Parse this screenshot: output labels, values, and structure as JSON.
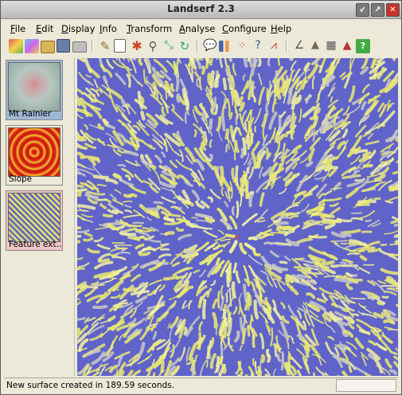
{
  "window": {
    "title": "Landserf 2.3"
  },
  "menu": [
    "File",
    "Edit",
    "Display",
    "Info",
    "Transform",
    "Analyse",
    "Configure",
    "Help"
  ],
  "toolbar_icons": [
    "new-surface-icon",
    "new-raster-icon",
    "open-folder-icon",
    "save-icon",
    "print-icon",
    "pencil-icon",
    "document-icon",
    "flow-icon",
    "magnify-icon",
    "transform-icon",
    "refresh-icon",
    "chat-icon",
    "bar-chart-icon",
    "scatter-plot-icon",
    "query-icon",
    "profile-chart-icon",
    "angle-icon",
    "terrain-icon",
    "grid-icon",
    "mountain-icon",
    "help-icon"
  ],
  "surfaces": [
    {
      "label": "Mt Rainier",
      "selected": true,
      "color": "#9fb8d6"
    },
    {
      "label": "Slope",
      "selected": false,
      "color": "#ece9d8"
    },
    {
      "label": "Feature ext...",
      "selected": false,
      "color": "#efc5c5"
    }
  ],
  "status": {
    "text": "New surface created in 189.59 seconds."
  },
  "colors": {
    "channel": "#5f63c5",
    "ridge": "#eaea72",
    "plane": "#c9c9c6",
    "peak": "#c25555"
  }
}
